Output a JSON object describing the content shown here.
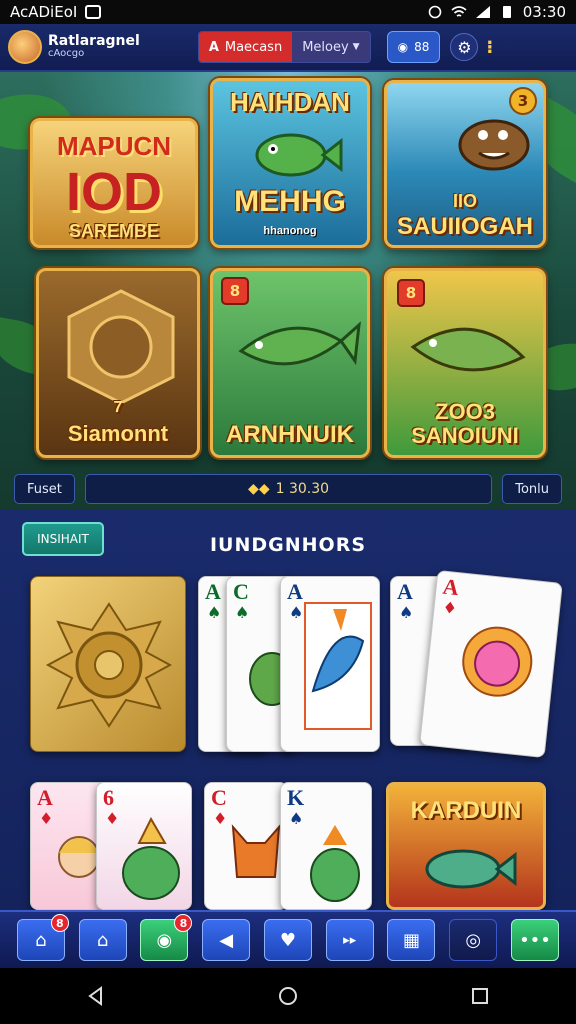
{
  "status_bar": {
    "carrier": "AcADiEoI",
    "time": "03:30"
  },
  "header": {
    "user_name": "Ratlaragnel",
    "user_sub": "cAocgo",
    "tab_active_mark": "A",
    "tab_active": "Maecasn",
    "tab_inactive": "Meloey",
    "coin_btn": "88"
  },
  "tiles": [
    {
      "title": "MAPUCN",
      "big": "IOD",
      "sub": "SAREMBE"
    },
    {
      "title": "HAIHDAN",
      "sub": "MEHHG",
      "note": "hhanonog"
    },
    {
      "badge": "3",
      "sub1": "IIO",
      "sub2": "SAUIIOGAH"
    },
    {
      "sub": "Siamonnt",
      "num": "7"
    },
    {
      "badge": "8",
      "sub": "ARNHNUIK"
    },
    {
      "badge": "8",
      "sub": "ZOO3",
      "sub2": "SANOIUNI"
    }
  ],
  "strip": {
    "left": "Fuset",
    "balance": "1 30.30",
    "right": "Tonlu"
  },
  "lower": {
    "section_btn": "INSIHAIT",
    "section_title": "IUNDGNHORS"
  },
  "cards": [
    {
      "rank": "A",
      "suit": "♠"
    },
    {
      "rank": "C",
      "suit": "♠"
    },
    {
      "rank": "A",
      "suit": "♠"
    },
    {
      "rank": "A",
      "suit": "♠"
    },
    {
      "rank": "A",
      "suit": "♦"
    },
    {
      "rank": "A",
      "suit": "♦"
    },
    {
      "rank": "6",
      "suit": "♦"
    },
    {
      "rank": "C",
      "suit": "♦"
    },
    {
      "rank": "K",
      "suit": "♠"
    },
    {
      "title": "KARDUIN"
    }
  ],
  "bottom_nav": {
    "home_badge": "8",
    "chat_badge": "8"
  },
  "colors": {
    "accent_red": "#d42b2b",
    "nav_blue": "#3a6df0",
    "gold": "#e9b34a"
  }
}
